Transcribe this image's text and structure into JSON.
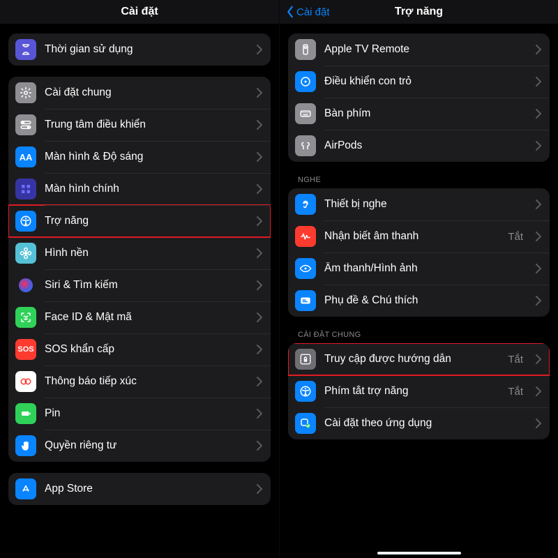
{
  "left": {
    "title": "Cài đặt",
    "groups": [
      {
        "rows": [
          {
            "key": "screentime",
            "label": "Thời gian sử dụng",
            "icon": "hourglass-icon",
            "color": "#5856d6"
          }
        ]
      },
      {
        "rows": [
          {
            "key": "general",
            "label": "Cài đặt chung",
            "icon": "gear-icon",
            "color": "#8e8e93"
          },
          {
            "key": "control",
            "label": "Trung tâm điều khiển",
            "icon": "switches-icon",
            "color": "#8e8e93"
          },
          {
            "key": "display",
            "label": "Màn hình & Độ sáng",
            "icon": "aa-icon",
            "color": "#0a84ff"
          },
          {
            "key": "home",
            "label": "Màn hình chính",
            "icon": "grid-icon",
            "color": "#3634a3"
          },
          {
            "key": "access",
            "label": "Trợ năng",
            "icon": "accessibility-icon",
            "color": "#0a84ff",
            "highlight": true
          },
          {
            "key": "wallpaper",
            "label": "Hình nền",
            "icon": "flower-icon",
            "color": "#56c1d6"
          },
          {
            "key": "siri",
            "label": "Siri & Tìm kiếm",
            "icon": "siri-icon",
            "color": "#1c1c1e"
          },
          {
            "key": "faceid",
            "label": "Face ID & Mật mã",
            "icon": "faceid-icon",
            "color": "#30d158"
          },
          {
            "key": "sos",
            "label": "SOS khẩn cấp",
            "icon": "sos-icon",
            "color": "#ff3b30"
          },
          {
            "key": "exposure",
            "label": "Thông báo tiếp xúc",
            "icon": "exposure-icon",
            "color": "#ffffff"
          },
          {
            "key": "battery",
            "label": "Pin",
            "icon": "battery-icon",
            "color": "#30d158"
          },
          {
            "key": "privacy",
            "label": "Quyền riêng tư",
            "icon": "hand-icon",
            "color": "#0a84ff"
          }
        ]
      },
      {
        "rows": [
          {
            "key": "appstore",
            "label": "App Store",
            "icon": "appstore-icon",
            "color": "#0a84ff"
          }
        ]
      }
    ]
  },
  "right": {
    "title": "Trợ năng",
    "back": "Cài đặt",
    "sections": [
      {
        "label": null,
        "rows": [
          {
            "key": "tvremote",
            "label": "Apple TV Remote",
            "icon": "remote-icon",
            "color": "#8e8e93"
          },
          {
            "key": "pointer",
            "label": "Điều khiển con trỏ",
            "icon": "pointer-icon",
            "color": "#0a84ff"
          },
          {
            "key": "keyboard",
            "label": "Bàn phím",
            "icon": "keyboard-icon",
            "color": "#8e8e93"
          },
          {
            "key": "airpods",
            "label": "AirPods",
            "icon": "airpods-icon",
            "color": "#8e8e93"
          }
        ]
      },
      {
        "label": "NGHE",
        "rows": [
          {
            "key": "hearing",
            "label": "Thiết bị nghe",
            "icon": "ear-icon",
            "color": "#0a84ff"
          },
          {
            "key": "soundrec",
            "label": "Nhận biết âm thanh",
            "icon": "soundrec-icon",
            "color": "#ff3b30",
            "value": "Tắt"
          },
          {
            "key": "av",
            "label": "Âm thanh/Hình ảnh",
            "icon": "eye-icon",
            "color": "#0a84ff"
          },
          {
            "key": "captions",
            "label": "Phụ đề & Chú thích",
            "icon": "captions-icon",
            "color": "#0a84ff"
          }
        ]
      },
      {
        "label": "CÀI ĐẶT CHUNG",
        "rows": [
          {
            "key": "guided",
            "label": "Truy cập được hướng dẫn",
            "icon": "lock-icon",
            "color": "#6e6e73",
            "value": "Tắt",
            "highlight": true
          },
          {
            "key": "shortcut",
            "label": "Phím tắt trợ năng",
            "icon": "accessibility-icon",
            "color": "#0a84ff",
            "value": "Tắt"
          },
          {
            "key": "perapp",
            "label": "Cài đặt theo ứng dụng",
            "icon": "perapp-icon",
            "color": "#0a84ff"
          }
        ]
      }
    ]
  }
}
